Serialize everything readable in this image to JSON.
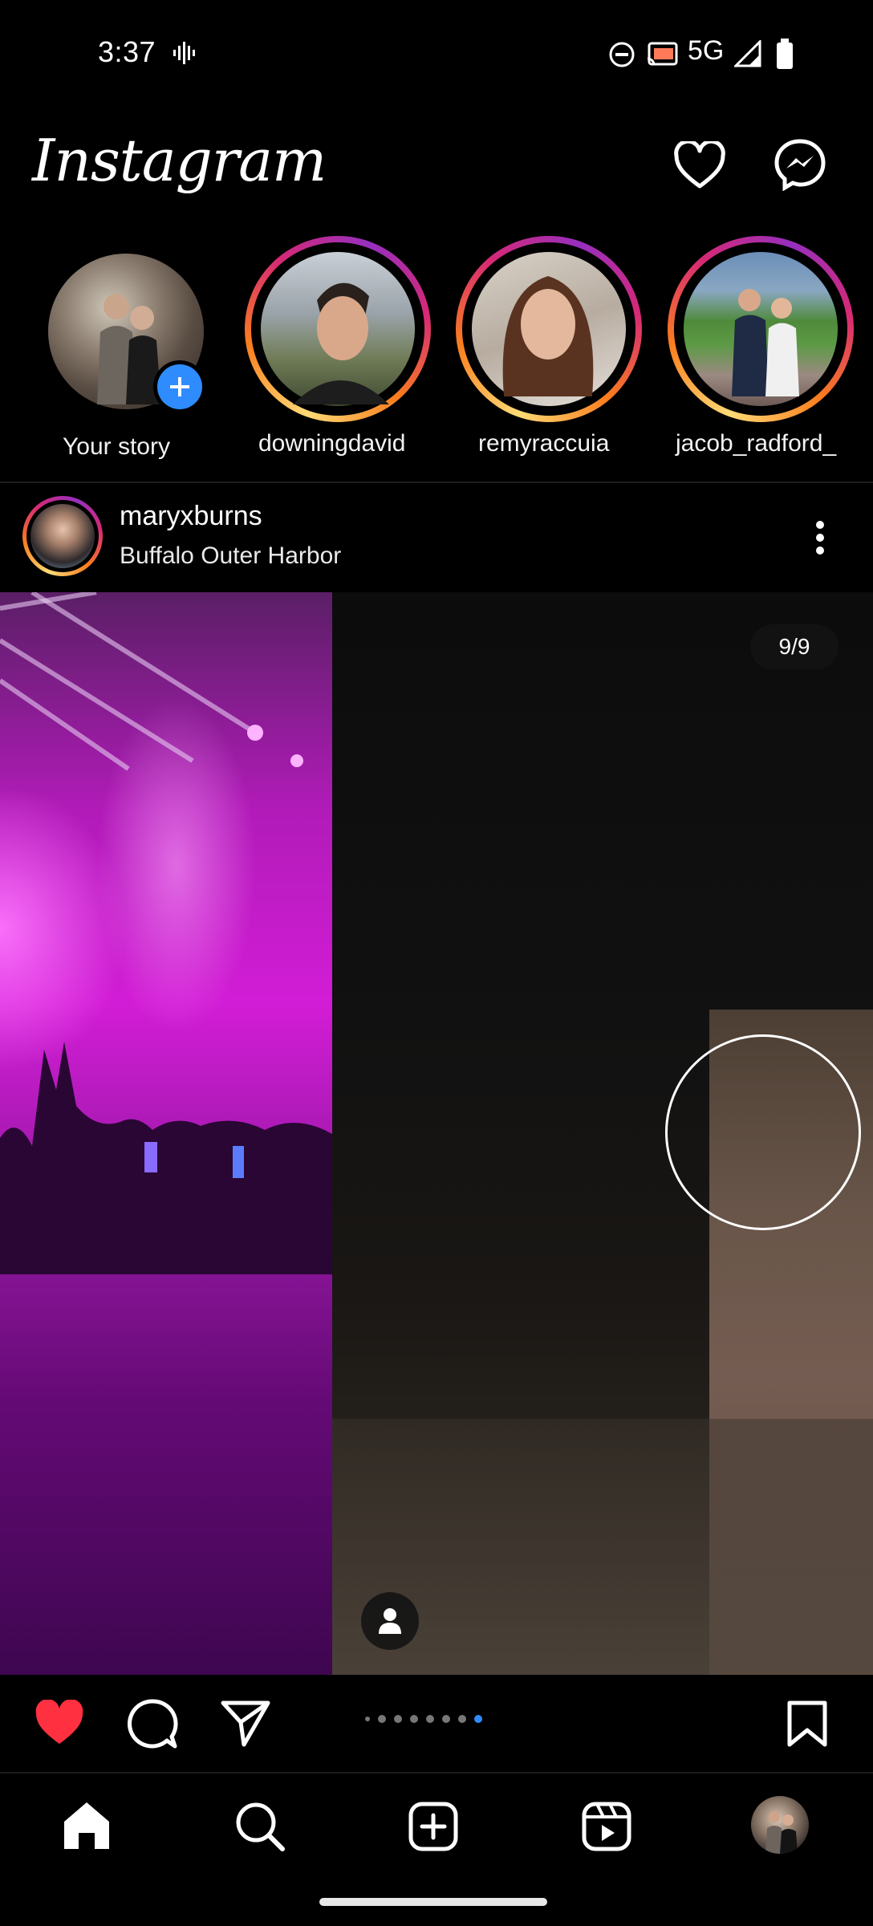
{
  "status_bar": {
    "time": "3:37",
    "network": "5G"
  },
  "header": {
    "logo": "Instagram"
  },
  "stories": [
    {
      "label": "Your story"
    },
    {
      "label": "downingdavid"
    },
    {
      "label": "remyraccuia"
    },
    {
      "label": "jacob_radford_"
    }
  ],
  "post": {
    "username": "maryxburns",
    "location": "Buffalo Outer Harbor",
    "counter": "9/9",
    "carousel_total": 9,
    "carousel_current": 9
  },
  "colors": {
    "accent_blue": "#2f8cff",
    "like_red": "#ff3040",
    "story_ring": [
      "#feda75",
      "#fa7e1e",
      "#d62976",
      "#962fbf"
    ]
  }
}
